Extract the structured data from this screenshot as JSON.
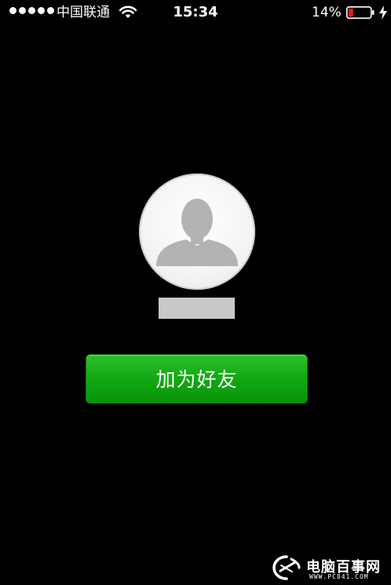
{
  "status_bar": {
    "carrier": "中国联通",
    "time": "15:34",
    "battery_percent": "14%",
    "signal_bars": 5,
    "battery_level": 0.14,
    "icons": [
      "signal-dots-icon",
      "wifi-icon",
      "battery-icon",
      "charging-bolt-icon"
    ]
  },
  "profile": {
    "avatar_icon": "default-avatar-icon"
  },
  "actions": {
    "add_friend_label": "加为好友"
  },
  "watermark": {
    "brand": "电脑百事网",
    "url": "WWW.PC841.COM"
  },
  "colors": {
    "background": "#000000",
    "button_green": "#12a812",
    "battery_low": "#e11b1b"
  }
}
